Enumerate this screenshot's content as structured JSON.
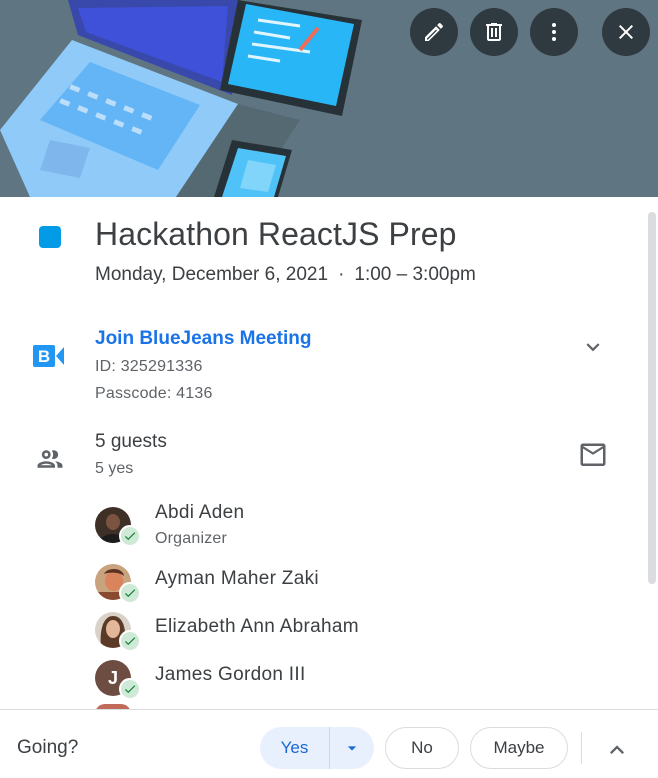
{
  "header": {
    "actions": [
      {
        "icon": "pencil-icon",
        "label": "Edit event"
      },
      {
        "icon": "trash-icon",
        "label": "Delete event"
      },
      {
        "icon": "more-vert-icon",
        "label": "Options"
      },
      {
        "icon": "close-icon",
        "label": "Close"
      }
    ]
  },
  "event": {
    "color": "#039be5",
    "title": "Hackathon ReactJS Prep",
    "date": "Monday, December 6, 2021",
    "separator": "·",
    "time": "1:00 – 3:00pm"
  },
  "conference": {
    "join_label": "Join BlueJeans Meeting",
    "id_line": "ID: 325291336",
    "passcode_line": "Passcode: 4136",
    "logo_letter": "B"
  },
  "guests": {
    "count_label": "5 guests",
    "status_label": "5 yes",
    "list": [
      {
        "name": "Abdi Aden",
        "role": "Organizer",
        "avatar": "photo",
        "response": "yes"
      },
      {
        "name": "Ayman Maher Zaki",
        "role": "",
        "avatar": "photo",
        "response": "yes"
      },
      {
        "name": "Elizabeth Ann Abraham",
        "role": "",
        "avatar": "photo",
        "response": "yes"
      },
      {
        "name": "James Gordon III",
        "role": "",
        "avatar": "J",
        "response": "yes"
      }
    ]
  },
  "footer": {
    "going_label": "Going?",
    "yes_label": "Yes",
    "no_label": "No",
    "maybe_label": "Maybe"
  },
  "colors": {
    "accent": "#1a73e8",
    "yes_bg": "#e8f0fe",
    "check_bg": "#ceead6",
    "check": "#188038"
  }
}
